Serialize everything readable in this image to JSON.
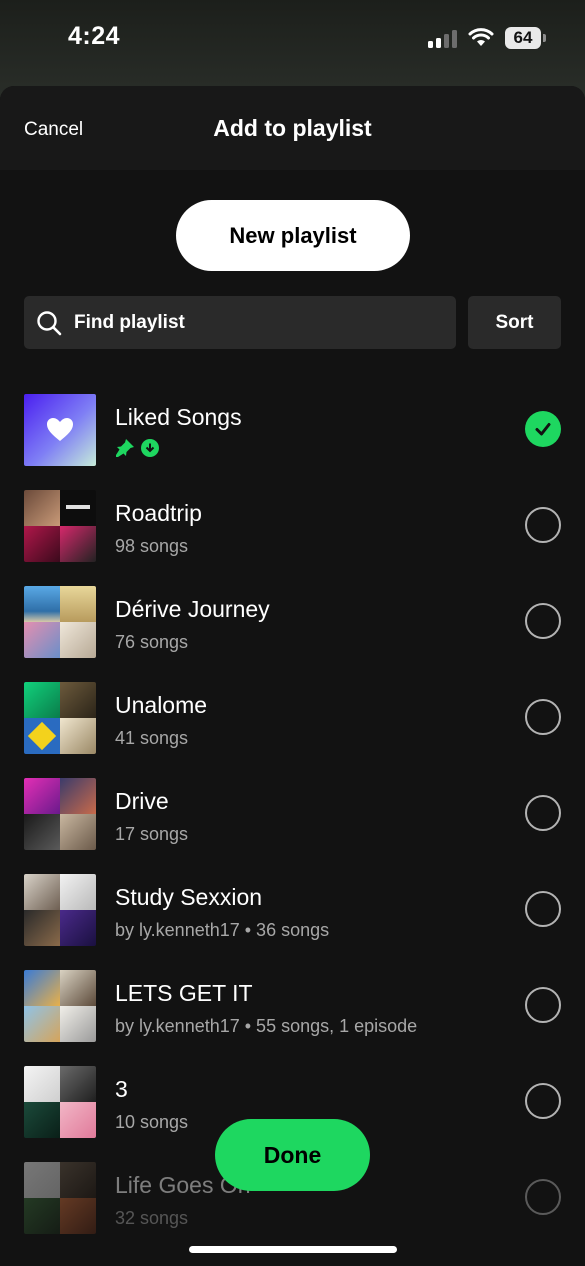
{
  "status_bar": {
    "time": "4:24",
    "battery": "64",
    "icons": [
      "signal-icon",
      "wifi-icon",
      "battery-icon"
    ]
  },
  "header": {
    "cancel_label": "Cancel",
    "title": "Add to playlist"
  },
  "new_playlist_label": "New playlist",
  "search": {
    "placeholder": "Find playlist",
    "icon": "search-icon"
  },
  "sort_label": "Sort",
  "playlists": [
    {
      "title": "Liked Songs",
      "subtitle": "",
      "selected": true,
      "icons": [
        "pin-icon",
        "download-icon"
      ]
    },
    {
      "title": "Roadtrip",
      "subtitle": "98 songs",
      "selected": false
    },
    {
      "title": "Dérive Journey",
      "subtitle": "76 songs",
      "selected": false
    },
    {
      "title": "Unalome",
      "subtitle": "41 songs",
      "selected": false
    },
    {
      "title": "Drive",
      "subtitle": "17 songs",
      "selected": false
    },
    {
      "title": "Study Sexxion",
      "subtitle": "by ly.kenneth17 • 36 songs",
      "selected": false
    },
    {
      "title": "LETS GET IT",
      "subtitle": "by ly.kenneth17 • 55 songs, 1 episode",
      "selected": false
    },
    {
      "title": "3",
      "subtitle": "10 songs",
      "selected": false
    },
    {
      "title": "Life Goes On",
      "subtitle": "32 songs",
      "selected": false
    }
  ],
  "done_label": "Done",
  "colors": {
    "accent_green": "#1ed760",
    "background": "#121212",
    "surface": "#2a2a2a",
    "secondary_text": "#a7a7a7"
  }
}
